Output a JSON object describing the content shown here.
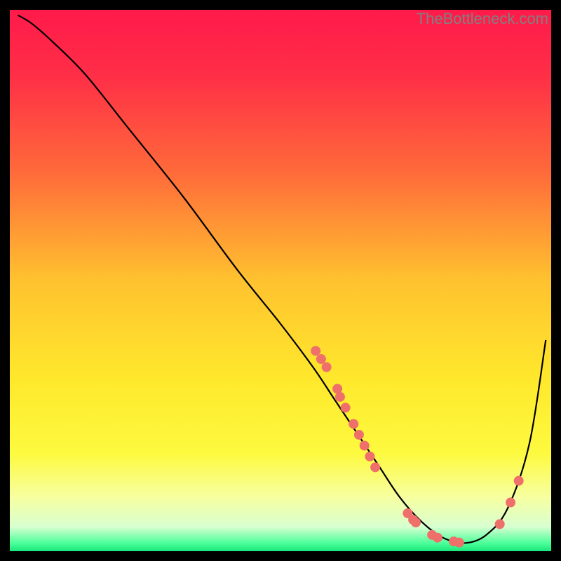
{
  "watermark": "TheBottleneck.com",
  "chart_data": {
    "type": "line",
    "title": "",
    "xlabel": "",
    "ylabel": "",
    "xlim": [
      0,
      100
    ],
    "ylim": [
      0,
      100
    ],
    "gradient_stops": [
      {
        "offset": 0.0,
        "color": "#ff1a4a"
      },
      {
        "offset": 0.12,
        "color": "#ff2e47"
      },
      {
        "offset": 0.3,
        "color": "#ff6a3a"
      },
      {
        "offset": 0.5,
        "color": "#ffc22f"
      },
      {
        "offset": 0.68,
        "color": "#ffe82c"
      },
      {
        "offset": 0.82,
        "color": "#fdfa3f"
      },
      {
        "offset": 0.9,
        "color": "#f7ffa0"
      },
      {
        "offset": 0.955,
        "color": "#d8ffd0"
      },
      {
        "offset": 0.985,
        "color": "#4dff9a"
      },
      {
        "offset": 1.0,
        "color": "#18e67a"
      }
    ],
    "series": [
      {
        "name": "bottleneck-curve",
        "x": [
          1.5,
          4,
          8,
          14,
          22,
          32,
          42,
          50,
          56,
          60,
          64,
          68,
          72,
          76,
          80,
          84,
          88,
          92,
          96,
          99
        ],
        "y": [
          99,
          97.5,
          94,
          88,
          78,
          65.5,
          52,
          42,
          34,
          28,
          22,
          16,
          10,
          5.5,
          2.5,
          1.5,
          3,
          8,
          20,
          39
        ]
      }
    ],
    "scatter": {
      "name": "highlighted-points",
      "color": "#ef6f6a",
      "points": [
        {
          "x": 56.5,
          "y": 37.0,
          "r": 7
        },
        {
          "x": 57.5,
          "y": 35.5,
          "r": 7
        },
        {
          "x": 58.5,
          "y": 34.0,
          "r": 7
        },
        {
          "x": 60.5,
          "y": 30.0,
          "r": 7
        },
        {
          "x": 61.0,
          "y": 28.5,
          "r": 7
        },
        {
          "x": 62.0,
          "y": 26.5,
          "r": 7
        },
        {
          "x": 63.5,
          "y": 23.5,
          "r": 7
        },
        {
          "x": 64.5,
          "y": 21.5,
          "r": 7
        },
        {
          "x": 65.5,
          "y": 19.5,
          "r": 7
        },
        {
          "x": 66.5,
          "y": 17.5,
          "r": 7
        },
        {
          "x": 67.5,
          "y": 15.5,
          "r": 7
        },
        {
          "x": 73.5,
          "y": 7.0,
          "r": 7
        },
        {
          "x": 74.5,
          "y": 5.8,
          "r": 7
        },
        {
          "x": 75.0,
          "y": 5.3,
          "r": 7
        },
        {
          "x": 78.0,
          "y": 3.0,
          "r": 7
        },
        {
          "x": 79.0,
          "y": 2.5,
          "r": 7
        },
        {
          "x": 82.0,
          "y": 1.8,
          "r": 7
        },
        {
          "x": 83.0,
          "y": 1.6,
          "r": 7
        },
        {
          "x": 90.5,
          "y": 5.0,
          "r": 7
        },
        {
          "x": 92.5,
          "y": 9.0,
          "r": 7
        },
        {
          "x": 94.0,
          "y": 13.0,
          "r": 7
        }
      ]
    }
  }
}
